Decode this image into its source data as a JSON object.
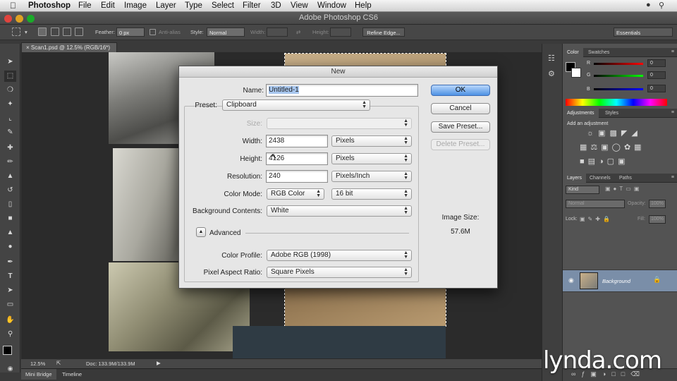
{
  "mac_menu": {
    "app": "Photoshop",
    "items": [
      "File",
      "Edit",
      "Image",
      "Layer",
      "Type",
      "Select",
      "Filter",
      "3D",
      "View",
      "Window",
      "Help"
    ]
  },
  "window_title": "Adobe Photoshop CS6",
  "options_bar": {
    "feather_label": "Feather:",
    "feather_value": "0 px",
    "antialias_label": "Anti-alias",
    "style_label": "Style:",
    "style_value": "Normal",
    "width_label": "Width:",
    "height_label": "Height:",
    "refine_edge": "Refine Edge...",
    "workspace": "Essentials"
  },
  "document_tab": "Scan1.psd @ 12.5% (RGB/16*)",
  "status": {
    "zoom": "12.5%",
    "doc": "Doc: 133.9M/133.9M"
  },
  "bottom_tabs": [
    "Mini Bridge",
    "Timeline"
  ],
  "color_panel": {
    "tabs": [
      "Color",
      "Swatches"
    ],
    "channels": [
      {
        "label": "R",
        "value": "0"
      },
      {
        "label": "G",
        "value": "0"
      },
      {
        "label": "B",
        "value": "0"
      }
    ]
  },
  "adjustments_panel": {
    "tabs": [
      "Adjustments",
      "Styles"
    ],
    "heading": "Add an adjustment"
  },
  "layers_panel": {
    "tabs": [
      "Layers",
      "Channels",
      "Paths"
    ],
    "kind": "Kind",
    "blend_mode": "Normal",
    "opacity_label": "Opacity:",
    "opacity_value": "100%",
    "lock_label": "Lock:",
    "fill_label": "Fill:",
    "fill_value": "100%",
    "layer_name": "Background"
  },
  "dialog": {
    "title": "New",
    "name_label": "Name:",
    "name_value": "Untitled-1",
    "preset_label": "Preset:",
    "preset_value": "Clipboard",
    "size_label": "Size:",
    "width_label": "Width:",
    "width_value": "2438",
    "width_unit": "Pixels",
    "height_label": "Height:",
    "height_value": "4126",
    "height_unit": "Pixels",
    "resolution_label": "Resolution:",
    "resolution_value": "240",
    "resolution_unit": "Pixels/Inch",
    "color_mode_label": "Color Mode:",
    "color_mode_value": "RGB Color",
    "bit_depth": "16 bit",
    "background_label": "Background Contents:",
    "background_value": "White",
    "advanced_label": "Advanced",
    "color_profile_label": "Color Profile:",
    "color_profile_value": "Adobe RGB (1998)",
    "pixel_aspect_label": "Pixel Aspect Ratio:",
    "pixel_aspect_value": "Square Pixels",
    "ok": "OK",
    "cancel": "Cancel",
    "save_preset": "Save Preset...",
    "delete_preset": "Delete Preset...",
    "image_size_label": "Image Size:",
    "image_size_value": "57.6M"
  },
  "watermark": "lynda.com",
  "colors": {
    "default_button": "#4d91e4",
    "layer_selected": "#7a8ea8",
    "panel_bg": "#535353"
  }
}
